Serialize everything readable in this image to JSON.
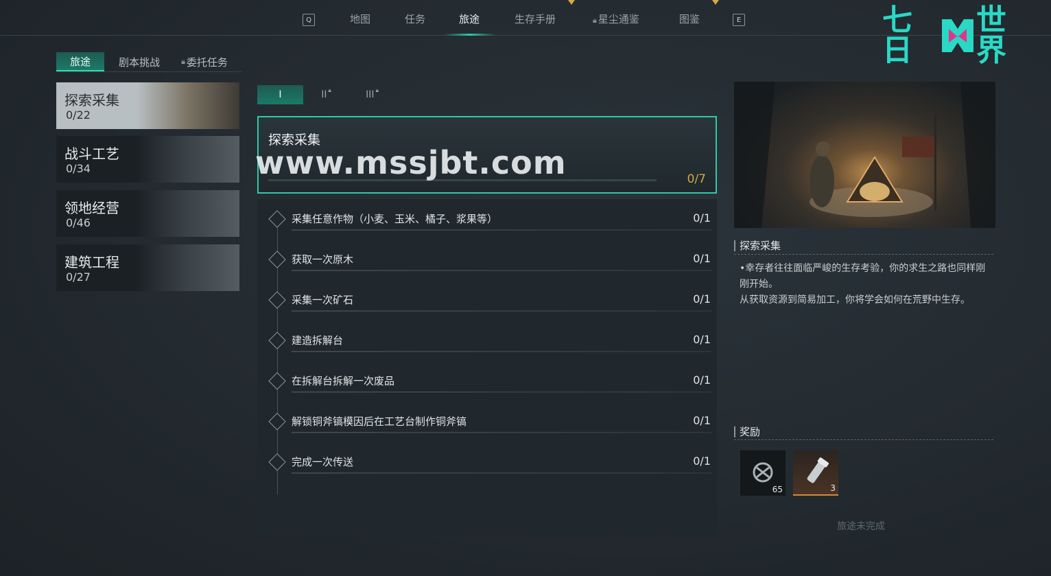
{
  "topnav": {
    "key_left": "Q",
    "key_right": "E",
    "tabs": [
      {
        "label": "地图",
        "locked": false
      },
      {
        "label": "任务",
        "locked": false
      },
      {
        "label": "旅途",
        "locked": false,
        "active": true
      },
      {
        "label": "生存手册",
        "locked": false
      },
      {
        "label": "星尘通鉴",
        "locked": true
      },
      {
        "label": "图鉴",
        "locked": false
      }
    ]
  },
  "logo": {
    "left": "七日",
    "right": "世界"
  },
  "subtabs": [
    {
      "label": "旅途",
      "active": true
    },
    {
      "label": "剧本挑战",
      "active": false
    },
    {
      "label": "委托任务",
      "locked": true
    }
  ],
  "categories": [
    {
      "name": "探索采集",
      "count": "0/22",
      "active": true
    },
    {
      "name": "战斗工艺",
      "count": "0/34"
    },
    {
      "name": "领地经营",
      "count": "0/46"
    },
    {
      "name": "建筑工程",
      "count": "0/27"
    }
  ],
  "levels": [
    {
      "label": "I",
      "active": true
    },
    {
      "label": "II",
      "locked": true
    },
    {
      "label": "III",
      "locked": true
    }
  ],
  "task": {
    "title": "探索采集",
    "progress": "0/7"
  },
  "watermark": "www.mssjbt.com",
  "objectives": [
    {
      "label": "采集任意作物（小麦、玉米、橘子、浆果等）",
      "value": "0/1"
    },
    {
      "label": "获取一次原木",
      "value": "0/1"
    },
    {
      "label": "采集一次矿石",
      "value": "0/1"
    },
    {
      "label": "建造拆解台",
      "value": "0/1"
    },
    {
      "label": "在拆解台拆解一次废品",
      "value": "0/1"
    },
    {
      "label": "解锁铜斧镐模因后在工艺台制作铜斧镐",
      "value": "0/1"
    },
    {
      "label": "完成一次传送",
      "value": "0/1"
    }
  ],
  "detail": {
    "title": "探索采集",
    "desc_1": "幸存者往往面临严峻的生存考验，你的求生之路也同样刚刚开始。",
    "desc_2": "从获取资源到简易加工，你将学会如何在荒野中生存。"
  },
  "rewards": {
    "title": "奖励",
    "items": [
      {
        "icon": "shuriken-token-icon",
        "amount": "65"
      },
      {
        "icon": "flashlight-icon",
        "amount": "3"
      }
    ]
  },
  "status": "旅途未完成",
  "colors": {
    "accent": "#2fc9ab",
    "progress": "#d4a94a",
    "logo": "#29d9c5",
    "logo_x": "#e0368a"
  }
}
